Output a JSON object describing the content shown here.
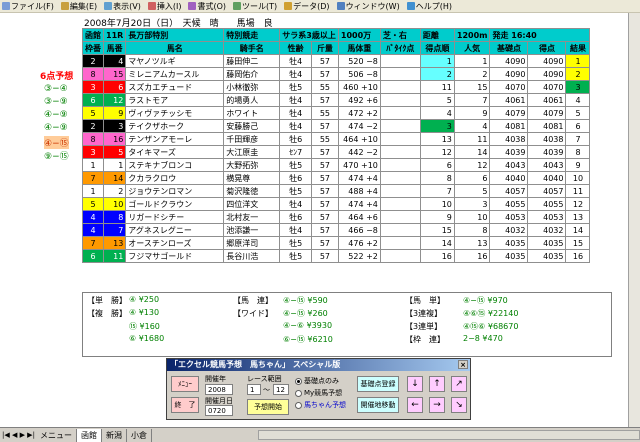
{
  "menu": [
    {
      "label": "ファイル(F)",
      "icon": "file-icon",
      "color": "#7a9cd6"
    },
    {
      "label": "編集(E)",
      "icon": "edit-icon",
      "color": "#c8a040"
    },
    {
      "label": "表示(V)",
      "icon": "view-icon",
      "color": "#60a0d0"
    },
    {
      "label": "挿入(I)",
      "icon": "insert-icon",
      "color": "#d06060"
    },
    {
      "label": "書式(O)",
      "icon": "format-icon",
      "color": "#a060c0"
    },
    {
      "label": "ツール(T)",
      "icon": "tools-icon",
      "color": "#60a060"
    },
    {
      "label": "データ(D)",
      "icon": "data-icon",
      "color": "#d0a030"
    },
    {
      "label": "ウィンドウ(W)",
      "icon": "window-icon",
      "color": "#5080c0"
    },
    {
      "label": "ヘルプ(H)",
      "icon": "help-icon",
      "color": "#4090d0"
    }
  ],
  "race": {
    "date_line": "2008年7月20日（日）　天候　晴　　馬場　良",
    "header": [
      "函館",
      "11R",
      "長万部特別",
      "特別競走",
      "サラ系3歳以上",
      "1000万",
      "芝・右",
      "距離",
      "1200m",
      "発走 16:40"
    ],
    "columns": [
      "枠番",
      "馬番",
      "馬名",
      "騎手名",
      "性齢",
      "斤量",
      "馬体重",
      "ﾊﾞﾀｲｸ点",
      "得点順",
      "人気",
      "基礎点",
      "得点",
      "結果"
    ]
  },
  "horses": [
    {
      "waku": "2",
      "uma": "4",
      "name": "マヤノツルギ",
      "jockey": "藤田伸二",
      "sexage": "牡4",
      "kin": "57",
      "weight": "520 −8",
      "batai": "",
      "rank": "1",
      "ninki": "1",
      "kiso": "4090",
      "score": "4090",
      "result": "1",
      "rank_color": "cyn",
      "ninki_color": "",
      "result_color": "ylw"
    },
    {
      "waku": "8",
      "uma": "15",
      "name": "ミレニアムカースル",
      "jockey": "藤岡佑介",
      "sexage": "牡4",
      "kin": "57",
      "weight": "506 −8",
      "batai": "",
      "rank": "2",
      "ninki": "2",
      "kiso": "4090",
      "score": "4090",
      "result": "2",
      "rank_color": "cyn",
      "ninki_color": "",
      "result_color": "ylw"
    },
    {
      "waku": "3",
      "uma": "6",
      "name": "スズカエチュード",
      "jockey": "小林徹弥",
      "sexage": "牡5",
      "kin": "55",
      "weight": "460 +10",
      "batai": "",
      "rank": "11",
      "ninki": "15",
      "kiso": "4070",
      "score": "4070",
      "result": "3",
      "rank_color": "",
      "ninki_color": "",
      "result_color": "grn"
    },
    {
      "waku": "6",
      "uma": "12",
      "name": "ラストモア",
      "jockey": "的場勇人",
      "sexage": "牡4",
      "kin": "57",
      "weight": "492 +6",
      "batai": "",
      "rank": "5",
      "ninki": "7",
      "kiso": "4061",
      "score": "4061",
      "result": "4",
      "rank_color": "",
      "ninki_color": "",
      "result_color": ""
    },
    {
      "waku": "5",
      "uma": "9",
      "name": "ヴィヴァチッシモ",
      "jockey": "ホワイト",
      "sexage": "牡4",
      "kin": "55",
      "weight": "472 +2",
      "batai": "",
      "rank": "4",
      "ninki": "9",
      "kiso": "4079",
      "score": "4079",
      "result": "5",
      "rank_color": "",
      "ninki_color": "",
      "result_color": ""
    },
    {
      "waku": "2",
      "uma": "3",
      "name": "テイクザホーク",
      "jockey": "安藤勝己",
      "sexage": "牡4",
      "kin": "57",
      "weight": "474 −2",
      "batai": "",
      "rank": "3",
      "ninki": "4",
      "kiso": "4081",
      "score": "4081",
      "result": "6",
      "rank_color": "grn",
      "ninki_color": "",
      "result_color": ""
    },
    {
      "waku": "8",
      "uma": "16",
      "name": "テンザンアモーレ",
      "jockey": "千田輝彦",
      "sexage": "牡6",
      "kin": "55",
      "weight": "464 +10",
      "batai": "",
      "rank": "13",
      "ninki": "11",
      "kiso": "4038",
      "score": "4038",
      "result": "7",
      "rank_color": "",
      "ninki_color": "",
      "result_color": ""
    },
    {
      "waku": "3",
      "uma": "5",
      "name": "タイキマーズ",
      "jockey": "大江原圭",
      "sexage": "ｾﾝ7",
      "kin": "57",
      "weight": "442 −2",
      "batai": "",
      "rank": "12",
      "ninki": "14",
      "kiso": "4039",
      "score": "4039",
      "result": "8",
      "rank_color": "",
      "ninki_color": "",
      "result_color": ""
    },
    {
      "waku": "1",
      "uma": "1",
      "name": "ステキナブロンコ",
      "jockey": "大野拓弥",
      "sexage": "牡5",
      "kin": "57",
      "weight": "470 +10",
      "batai": "",
      "rank": "6",
      "ninki": "12",
      "kiso": "4043",
      "score": "4043",
      "result": "9",
      "rank_color": "",
      "ninki_color": "",
      "result_color": ""
    },
    {
      "waku": "7",
      "uma": "14",
      "name": "クカラクロウ",
      "jockey": "横晃尊",
      "sexage": "牡6",
      "kin": "57",
      "weight": "474 +4",
      "batai": "",
      "rank": "8",
      "ninki": "6",
      "kiso": "4040",
      "score": "4040",
      "result": "10",
      "rank_color": "",
      "ninki_color": "",
      "result_color": ""
    },
    {
      "waku": "1",
      "uma": "2",
      "name": "ジョウテンロマン",
      "jockey": "菊沢隆徳",
      "sexage": "牡5",
      "kin": "57",
      "weight": "488 +4",
      "batai": "",
      "rank": "7",
      "ninki": "5",
      "kiso": "4057",
      "score": "4057",
      "result": "11",
      "rank_color": "",
      "ninki_color": "",
      "result_color": ""
    },
    {
      "waku": "5",
      "uma": "10",
      "name": "ゴールドクラウン",
      "jockey": "四位洋文",
      "sexage": "牡4",
      "kin": "57",
      "weight": "474 +4",
      "batai": "",
      "rank": "10",
      "ninki": "3",
      "kiso": "4055",
      "score": "4055",
      "result": "12",
      "rank_color": "",
      "ninki_color": "",
      "result_color": ""
    },
    {
      "waku": "4",
      "uma": "8",
      "name": "リガードシチー",
      "jockey": "北村友一",
      "sexage": "牡6",
      "kin": "57",
      "weight": "464 +6",
      "batai": "",
      "rank": "9",
      "ninki": "10",
      "kiso": "4053",
      "score": "4053",
      "result": "13",
      "rank_color": "",
      "ninki_color": "",
      "result_color": ""
    },
    {
      "waku": "4",
      "uma": "7",
      "name": "アグネスレグニー",
      "jockey": "池添謙一",
      "sexage": "牡4",
      "kin": "57",
      "weight": "466 −8",
      "batai": "",
      "rank": "15",
      "ninki": "8",
      "kiso": "4032",
      "score": "4032",
      "result": "14",
      "rank_color": "",
      "ninki_color": "",
      "result_color": ""
    },
    {
      "waku": "7",
      "uma": "13",
      "name": "オースチンローズ",
      "jockey": "郷原洋司",
      "sexage": "牡5",
      "kin": "57",
      "weight": "476 +2",
      "batai": "",
      "rank": "14",
      "ninki": "13",
      "kiso": "4035",
      "score": "4035",
      "result": "15",
      "rank_color": "",
      "ninki_color": "",
      "result_color": ""
    },
    {
      "waku": "6",
      "uma": "11",
      "name": "フジマサゴールド",
      "jockey": "長谷川浩",
      "sexage": "牡5",
      "kin": "57",
      "weight": "522 +2",
      "batai": "",
      "rank": "16",
      "ninki": "16",
      "kiso": "4035",
      "score": "4035",
      "result": "16",
      "rank_color": "",
      "ninki_color": "",
      "result_color": ""
    }
  ],
  "yoso": {
    "title": "6点予想",
    "items": [
      {
        "label": "③−④",
        "highlight": false
      },
      {
        "label": "③−⑨",
        "highlight": false
      },
      {
        "label": "④−⑨",
        "highlight": false
      },
      {
        "label": "④−⑨",
        "highlight": false
      },
      {
        "label": "④−⑮",
        "highlight": true
      },
      {
        "label": "⑨−⑮",
        "highlight": false
      }
    ]
  },
  "payout": {
    "tansho_label": "【単　勝】",
    "tansho_val": "④ ¥250",
    "fukusho_label": "【複　勝】",
    "fukusho_1": "④ ¥130",
    "fukusho_2": "⑮ ¥160",
    "fukusho_3": "⑥ ¥1680",
    "umaren_label": "【馬　連】",
    "umaren_val": "④−⑮ ¥590",
    "wide_label": "【ワイド】",
    "wide_1": "④−⑮ ¥260",
    "wide_2": "④−⑥ ¥3930",
    "wide_3": "⑥−⑮ ¥6210",
    "umatan_label": "【馬　単】",
    "umatan_val": "④−⑮ ¥970",
    "sanrenpuku_label": "【3連複】",
    "sanrenpuku_val": "④⑥⑮ ¥22140",
    "sanrentan_label": "【3連単】",
    "sanrentan_val": "④⑮⑥ ¥68670",
    "waku_label": "【枠　連】",
    "waku_val": "2−8 ¥470"
  },
  "dialog": {
    "title": "「エクセル競馬予想　馬ちゃん」 スペシャル版",
    "close": "×",
    "menu_btn": "ﾒﾆｭｰ",
    "end_btn": "終　了",
    "year_label": "開催年",
    "year_val": "2008",
    "date_label": "開催月日",
    "date_val": "0720",
    "range_label": "レース範囲",
    "range_from": "1",
    "range_sep": "〜",
    "range_to": "12",
    "start_btn": "予想開始",
    "radio_1": "基礎点のみ",
    "radio_2": "My競馬予想",
    "radio_3": "馬ちゃん予想",
    "reg_btn": "基礎点登録",
    "move_btn": "開催地移動"
  },
  "tabs": {
    "nav": "|◀ ◀ ▶ ▶|",
    "items": [
      "メニュー",
      "函館",
      "新潟",
      "小倉"
    ],
    "active": 1
  }
}
